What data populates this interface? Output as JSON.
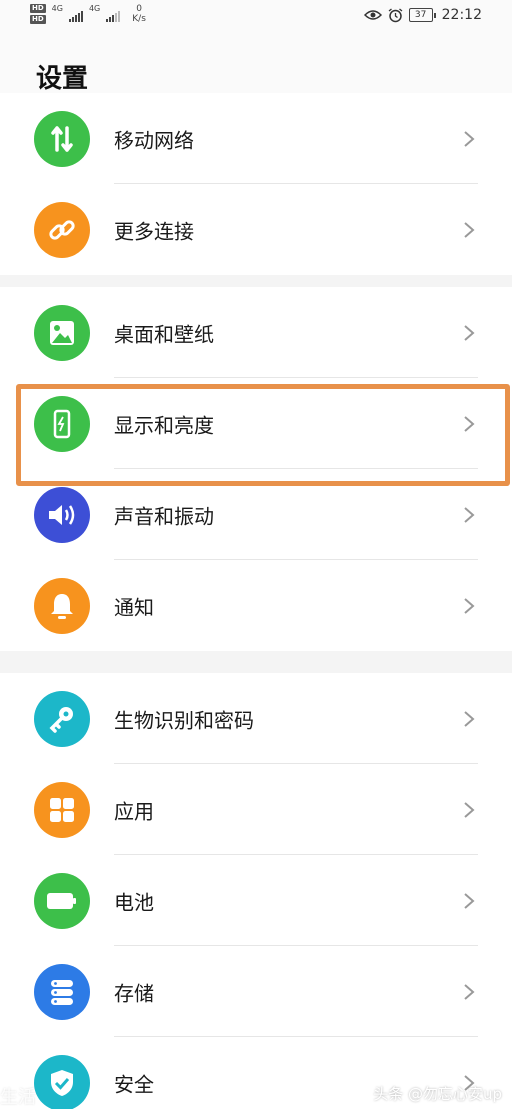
{
  "status_bar": {
    "sim1": "HD",
    "sim2": "HD",
    "network1": "4G",
    "network2": "4G",
    "speed_value": "0",
    "speed_unit": "K/s",
    "battery": "37",
    "time": "22:12"
  },
  "title": "设置",
  "groups": [
    {
      "items": [
        {
          "label": "移动网络",
          "icon": "mobile-data-icon",
          "color": "#3dbf4a"
        },
        {
          "label": "更多连接",
          "icon": "link-icon",
          "color": "#f7931e"
        }
      ]
    },
    {
      "items": [
        {
          "label": "桌面和壁纸",
          "icon": "wallpaper-icon",
          "color": "#3dbf4a"
        },
        {
          "label": "显示和亮度",
          "icon": "display-brightness-icon",
          "color": "#3dbf4a"
        },
        {
          "label": "声音和振动",
          "icon": "sound-icon",
          "color": "#3d4fd6"
        },
        {
          "label": "通知",
          "icon": "bell-icon",
          "color": "#f7931e"
        }
      ]
    },
    {
      "items": [
        {
          "label": "生物识别和密码",
          "icon": "key-icon",
          "color": "#1cb7c9"
        },
        {
          "label": "应用",
          "icon": "apps-icon",
          "color": "#f7931e"
        },
        {
          "label": "电池",
          "icon": "battery-icon",
          "color": "#3dbf4a"
        },
        {
          "label": "存储",
          "icon": "storage-icon",
          "color": "#2d7be6"
        },
        {
          "label": "安全",
          "icon": "shield-icon",
          "color": "#1cb7c9"
        }
      ]
    }
  ],
  "highlight_color": "#e8914a",
  "watermark_left": "生活",
  "watermark_right": "头条 @勿忘心安up"
}
